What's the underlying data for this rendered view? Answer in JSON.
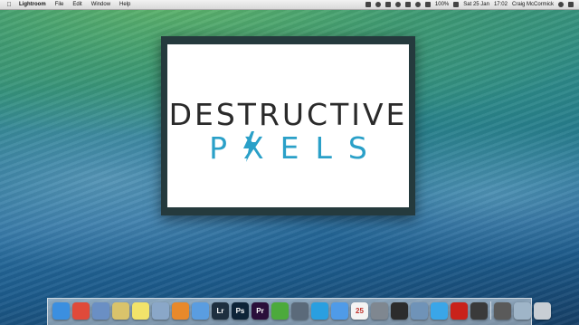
{
  "menubar": {
    "app_name": "Lightroom",
    "items": [
      "File",
      "Edit",
      "Window",
      "Help"
    ],
    "status": {
      "battery": "100%",
      "date": "Sat 25 Jan",
      "time": "17:02",
      "user": "Craig McCormick"
    }
  },
  "splash": {
    "logo_line1": "DESTRUCTIVE",
    "logo_line2": "PXELS",
    "bolt_color": "#2aa0c8"
  },
  "dock": {
    "icons": [
      {
        "name": "finder-icon",
        "color": "#3b8fe0",
        "label": ""
      },
      {
        "name": "chrome-icon",
        "color": "#e04a3a",
        "label": ""
      },
      {
        "name": "mail-icon",
        "color": "#6a8fc4",
        "label": ""
      },
      {
        "name": "notes-icon",
        "color": "#d9c36b",
        "label": ""
      },
      {
        "name": "stickies-icon",
        "color": "#f2e36a",
        "label": ""
      },
      {
        "name": "preview-icon",
        "color": "#8aa7c8",
        "label": ""
      },
      {
        "name": "ibooks-icon",
        "color": "#e8892b",
        "label": ""
      },
      {
        "name": "itunes-icon",
        "color": "#5a9de0",
        "label": ""
      },
      {
        "name": "lightroom-icon",
        "color": "#1e2f3f",
        "label": "Lr"
      },
      {
        "name": "photoshop-icon",
        "color": "#0d2438",
        "label": "Ps"
      },
      {
        "name": "premiere-icon",
        "color": "#2a0f3a",
        "label": "Pr"
      },
      {
        "name": "evernote-icon",
        "color": "#4caa3c",
        "label": ""
      },
      {
        "name": "tools-icon",
        "color": "#5b6a7a",
        "label": ""
      },
      {
        "name": "skype-icon",
        "color": "#2a9fe0",
        "label": ""
      },
      {
        "name": "messages-icon",
        "color": "#4f9be8",
        "label": ""
      },
      {
        "name": "calendar-icon",
        "color": "#f4f4f4",
        "label": "25"
      },
      {
        "name": "system-prefs-icon",
        "color": "#7f8790",
        "label": ""
      },
      {
        "name": "activity-monitor-icon",
        "color": "#2c2c2c",
        "label": ""
      },
      {
        "name": "onepassword-icon",
        "color": "#6f93b8",
        "label": ""
      },
      {
        "name": "twitter-icon",
        "color": "#3aa6e8",
        "label": ""
      },
      {
        "name": "acrobat-icon",
        "color": "#c9221b",
        "label": ""
      },
      {
        "name": "photos-icon",
        "color": "#3a3a3a",
        "label": ""
      },
      {
        "name": "script-icon",
        "color": "#5a5a5a",
        "label": ""
      },
      {
        "name": "downloads-icon",
        "color": "#9fb5c8",
        "label": ""
      },
      {
        "name": "trash-icon",
        "color": "#c8ced4",
        "label": ""
      }
    ]
  }
}
